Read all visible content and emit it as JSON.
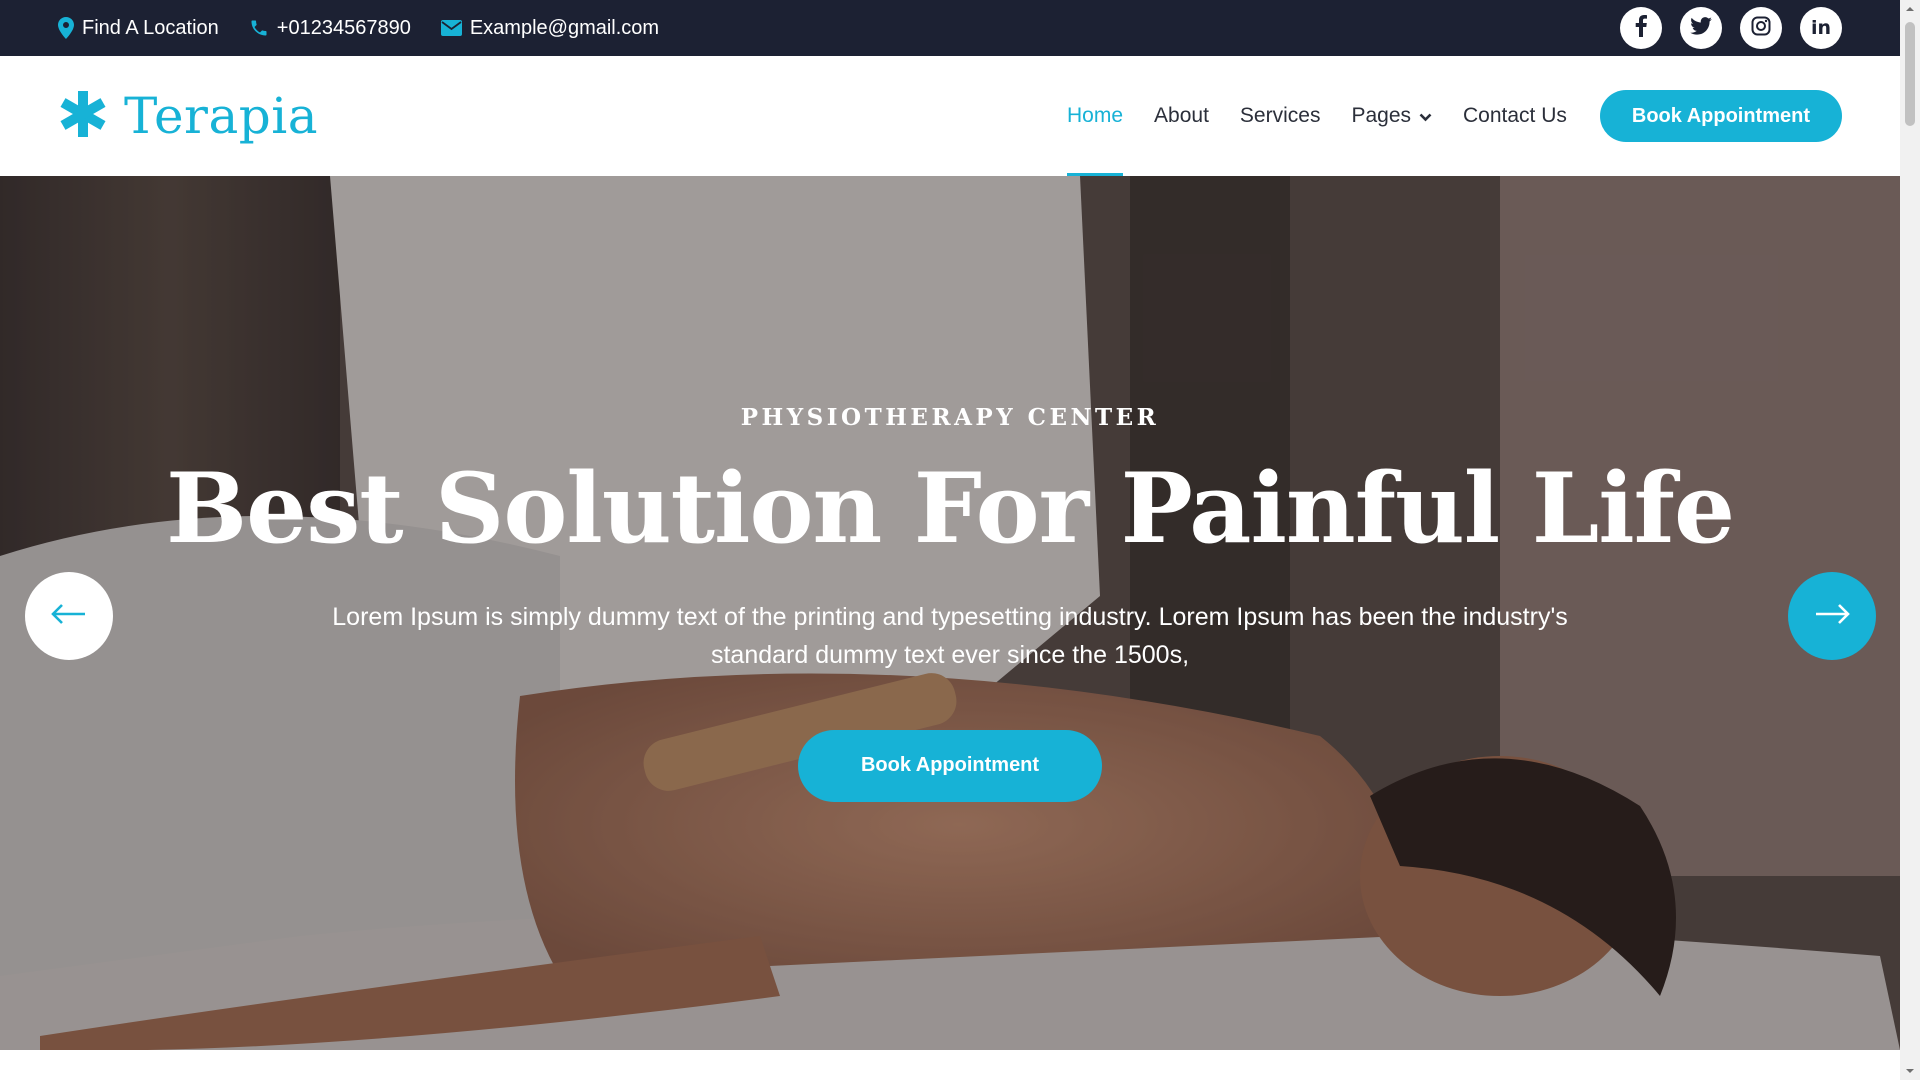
{
  "topbar": {
    "location": "Find A Location",
    "phone": "+01234567890",
    "email": "Example@gmail.com",
    "socials": [
      "facebook-icon",
      "twitter-icon",
      "instagram-icon",
      "linkedin-icon"
    ],
    "linkedin_text": "in"
  },
  "header": {
    "logo_text": "Terapia",
    "nav": {
      "home": "Home",
      "about": "About",
      "services": "Services",
      "pages": "Pages",
      "contact": "Contact Us"
    },
    "cta": "Book Appointment"
  },
  "hero": {
    "eyebrow": "PHYSIOTHERAPY CENTER",
    "title": "Best Solution For Painful Life",
    "description": "Lorem Ipsum is simply dummy text of the printing and typesetting industry. Lorem Ipsum has been the industry's standard dummy text ever since the 1500s,",
    "cta": "Book Appointment"
  },
  "colors": {
    "accent": "#17b2d6",
    "topbar_bg": "#1c2133",
    "nav_text": "#2b2f3a"
  }
}
